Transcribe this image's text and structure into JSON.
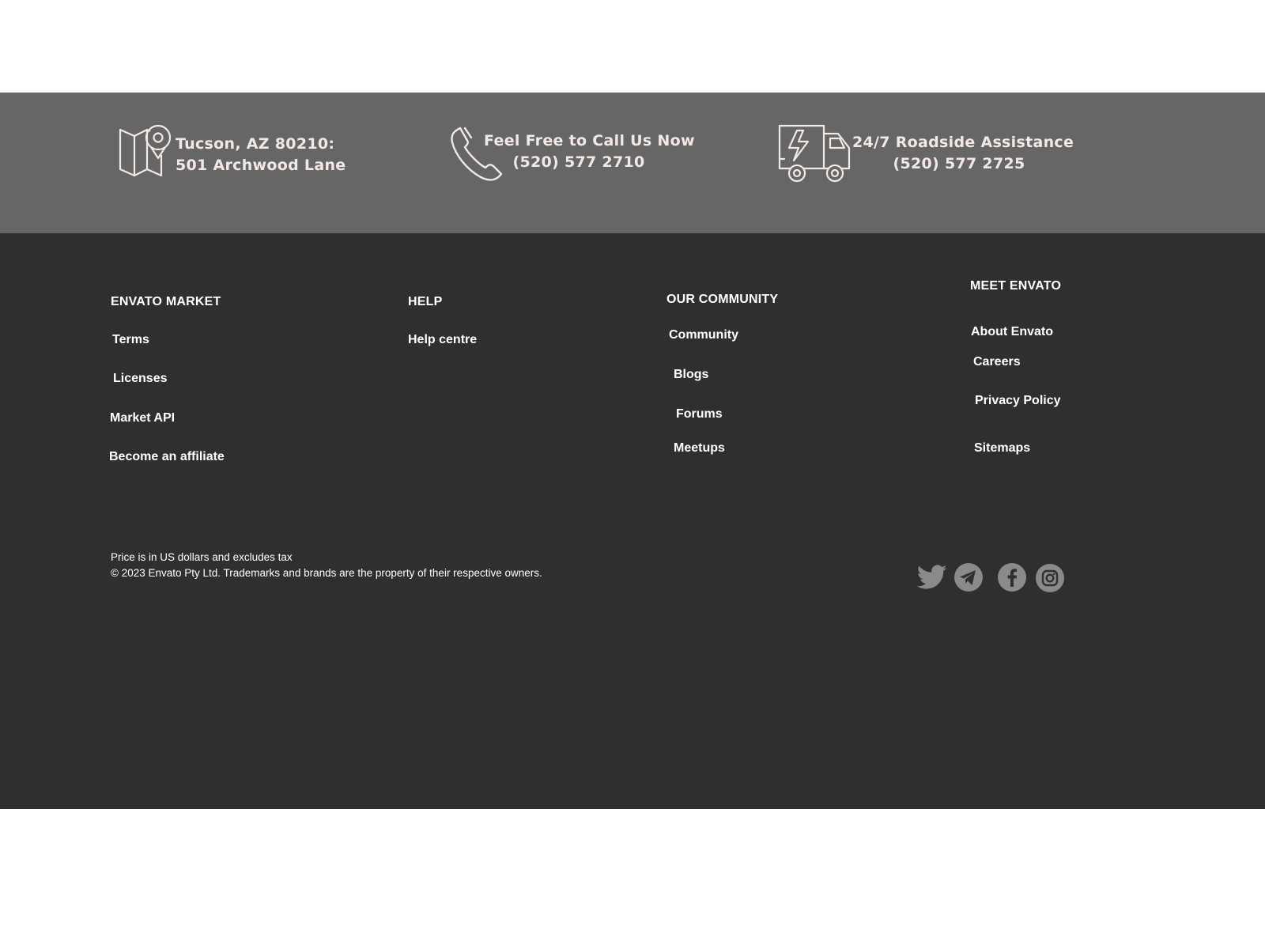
{
  "contact_band": {
    "address": {
      "line1": "Tucson, AZ 80210:",
      "line2": "501 Archwood Lane",
      "icon": "map-pin-icon"
    },
    "phone": {
      "line1": "Feel Free to Call Us Now",
      "line2": "(520) 577 2710",
      "icon": "phone-icon"
    },
    "roadside": {
      "line1": "24/7 Roadside Assistance",
      "line2": "(520) 577 2725",
      "icon": "delivery-truck-icon"
    }
  },
  "footer": {
    "envato_market": {
      "heading": "ENVATO MARKET",
      "links": [
        "Terms",
        "Licenses",
        "Market API",
        "Become an affiliate"
      ]
    },
    "help": {
      "heading": "HELP",
      "links": [
        "Help centre"
      ]
    },
    "community": {
      "heading": "OUR COMMUNITY",
      "links": [
        "Community",
        "Blogs",
        "Forums",
        "Meetups"
      ]
    },
    "meet_envato": {
      "heading": "MEET ENVATO",
      "links": [
        "About Envato",
        "Careers",
        "Privacy Policy",
        "Sitemaps"
      ]
    },
    "legal": {
      "price_note": "Price is in US dollars and excludes tax",
      "copyright": "© 2023 Envato Pty Ltd. Trademarks and brands are the property of their respective owners."
    },
    "social": [
      "twitter-icon",
      "telegram-icon",
      "facebook-icon",
      "instagram-icon"
    ]
  },
  "colors": {
    "band_bg": "#666666",
    "footer_bg": "#2f2f2f",
    "contact_text": "#f3e9e4",
    "social_icon": "#8a8a8a"
  }
}
